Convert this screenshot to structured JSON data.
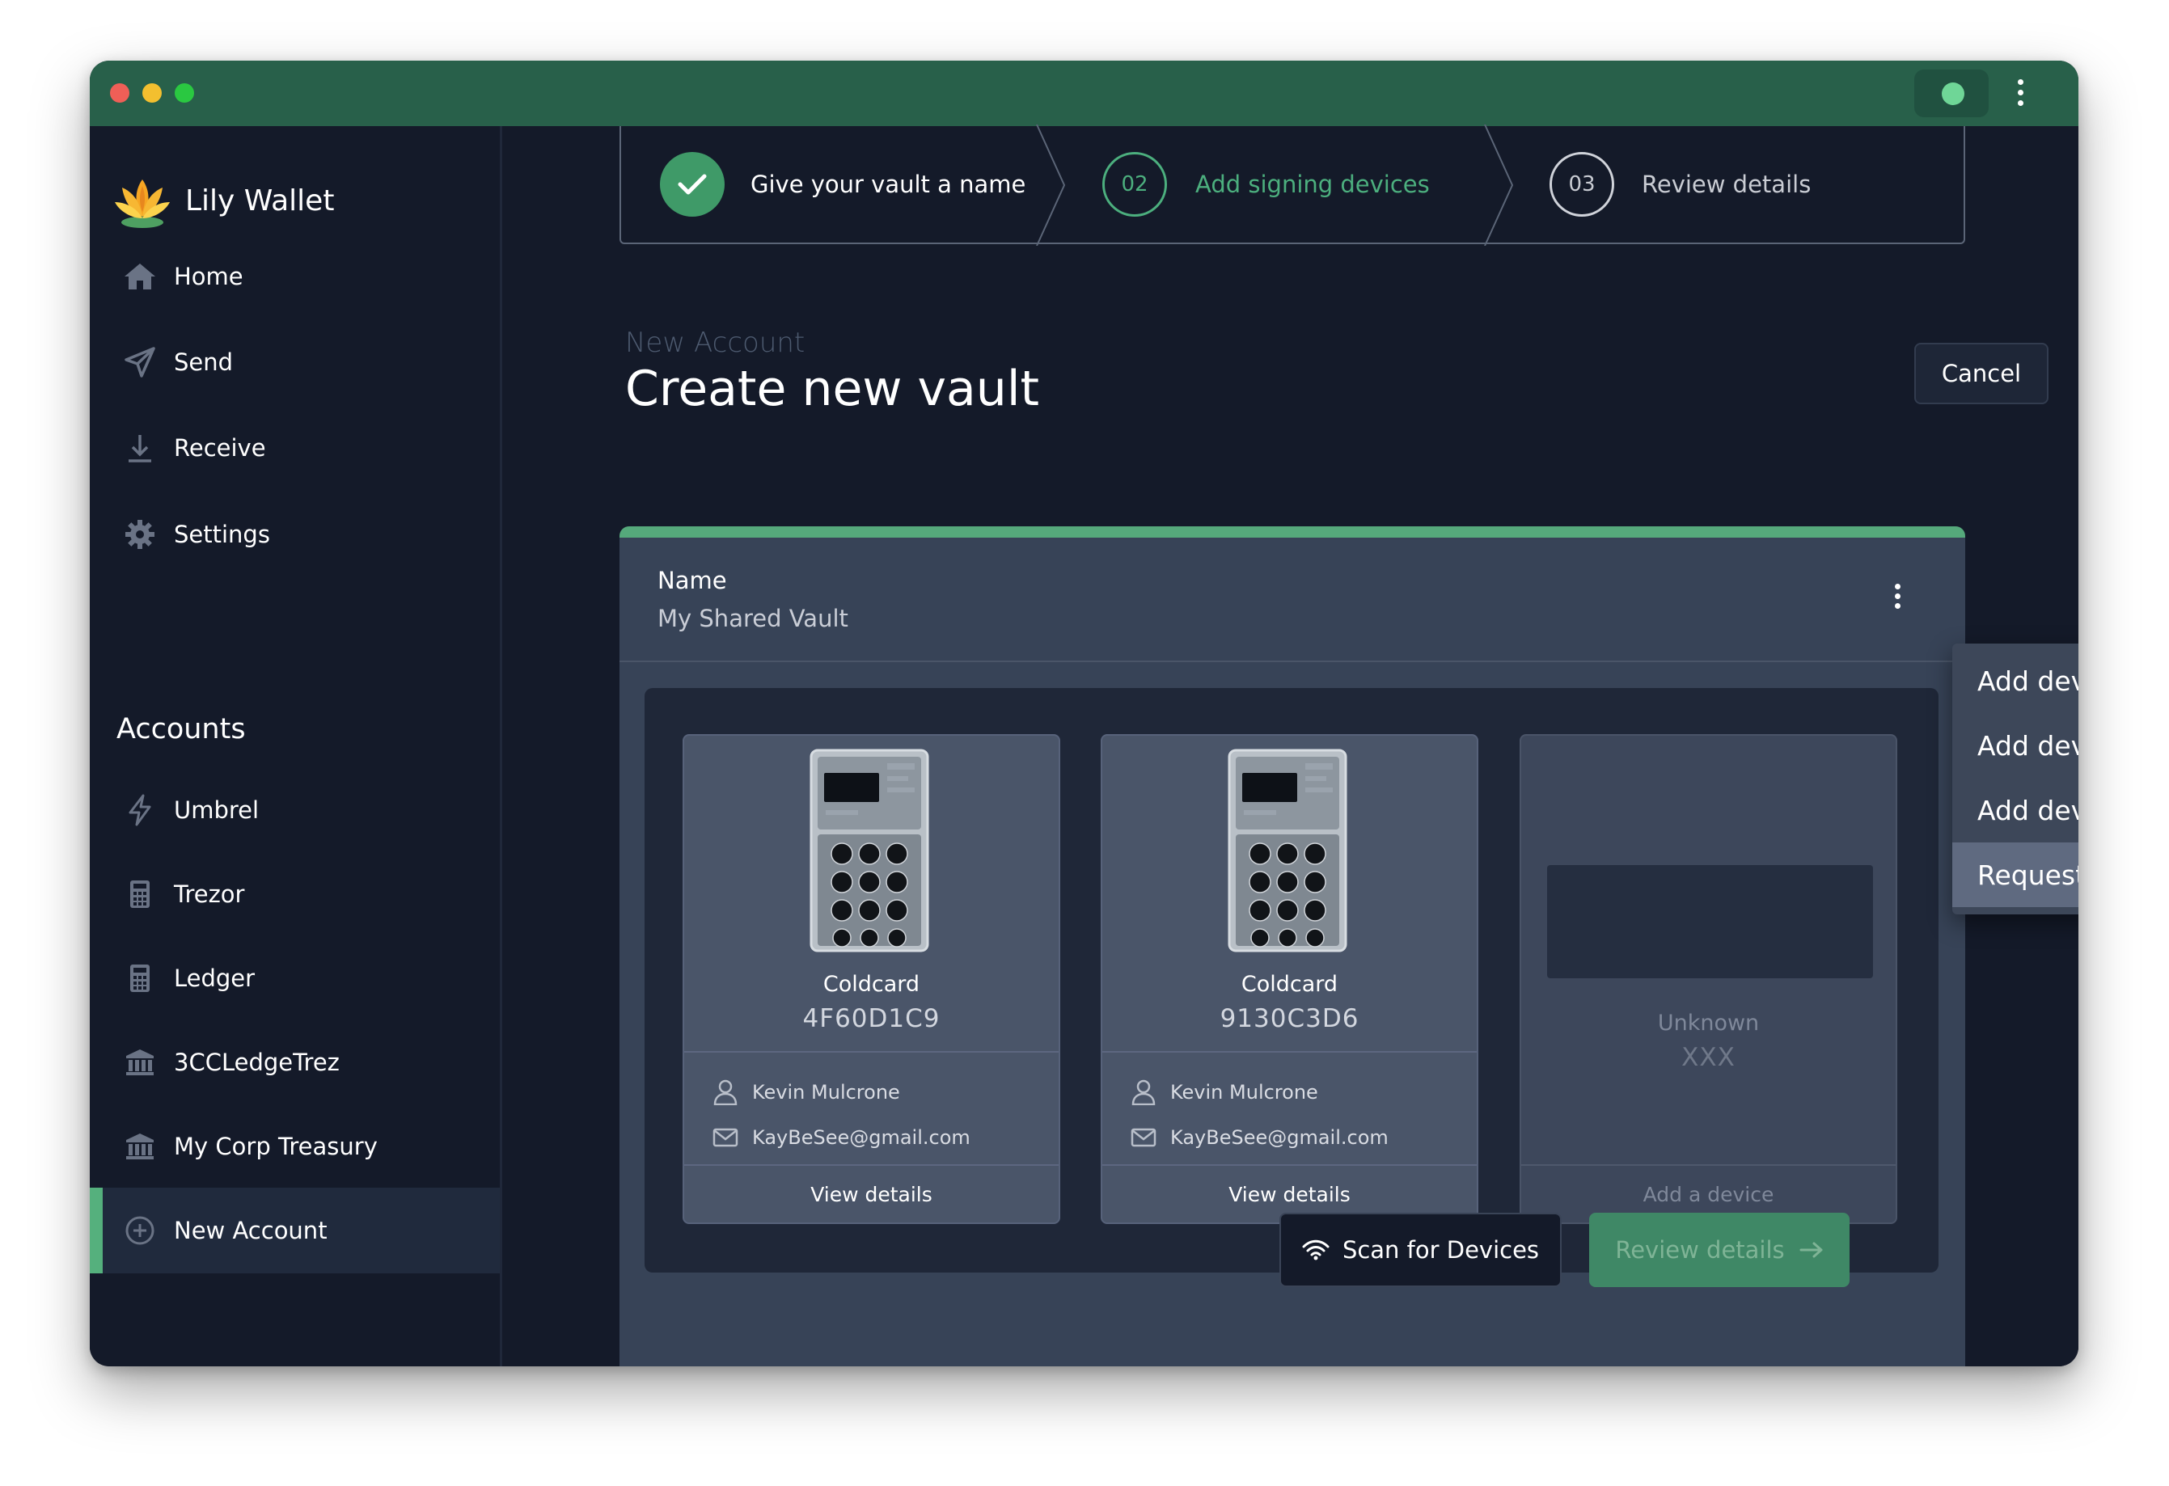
{
  "app": {
    "title": "Lily Wallet"
  },
  "colors": {
    "accent": "#55a97b",
    "titlebar": "#28604a",
    "background": "#141a29"
  },
  "sidebar": {
    "brand": "Lily Wallet",
    "nav": [
      {
        "label": "Home",
        "icon": "home-icon"
      },
      {
        "label": "Send",
        "icon": "send-icon"
      },
      {
        "label": "Receive",
        "icon": "download-icon"
      },
      {
        "label": "Settings",
        "icon": "gear-icon"
      }
    ],
    "accounts_title": "Accounts",
    "accounts": [
      {
        "label": "Umbrel",
        "icon": "lightning-icon"
      },
      {
        "label": "Trezor",
        "icon": "calculator-icon"
      },
      {
        "label": "Ledger",
        "icon": "calculator-icon"
      },
      {
        "label": "3CCLedgeTrez",
        "icon": "bank-icon"
      },
      {
        "label": "My Corp Treasury",
        "icon": "bank-icon"
      }
    ],
    "new_account": "New Account"
  },
  "stepper": {
    "steps": [
      {
        "number": "",
        "label": "Give your vault a name",
        "state": "complete"
      },
      {
        "number": "02",
        "label": "Add signing devices",
        "state": "active"
      },
      {
        "number": "03",
        "label": "Review details",
        "state": "upcoming"
      }
    ]
  },
  "header": {
    "subtitle": "New Account",
    "title": "Create new vault",
    "cancel_label": "Cancel"
  },
  "vault": {
    "name_label": "Name",
    "name_value": "My Shared Vault"
  },
  "devices": [
    {
      "type": "Coldcard",
      "fingerprint": "4F60D1C9",
      "owner": "Kevin Mulcrone",
      "email": "KayBeSee@gmail.com",
      "action": "View details"
    },
    {
      "type": "Coldcard",
      "fingerprint": "9130C3D6",
      "owner": "Kevin Mulcrone",
      "email": "KayBeSee@gmail.com",
      "action": "View details"
    },
    {
      "type": "Unknown",
      "fingerprint": "XXX",
      "action": "Add a device"
    }
  ],
  "menu": {
    "items": [
      "Add device from file",
      "Add device from QR code",
      "Add device manually",
      "Request device via URL"
    ],
    "hovered": 3
  },
  "footer": {
    "scan_label": "Scan for Devices",
    "review_label": "Review details"
  }
}
